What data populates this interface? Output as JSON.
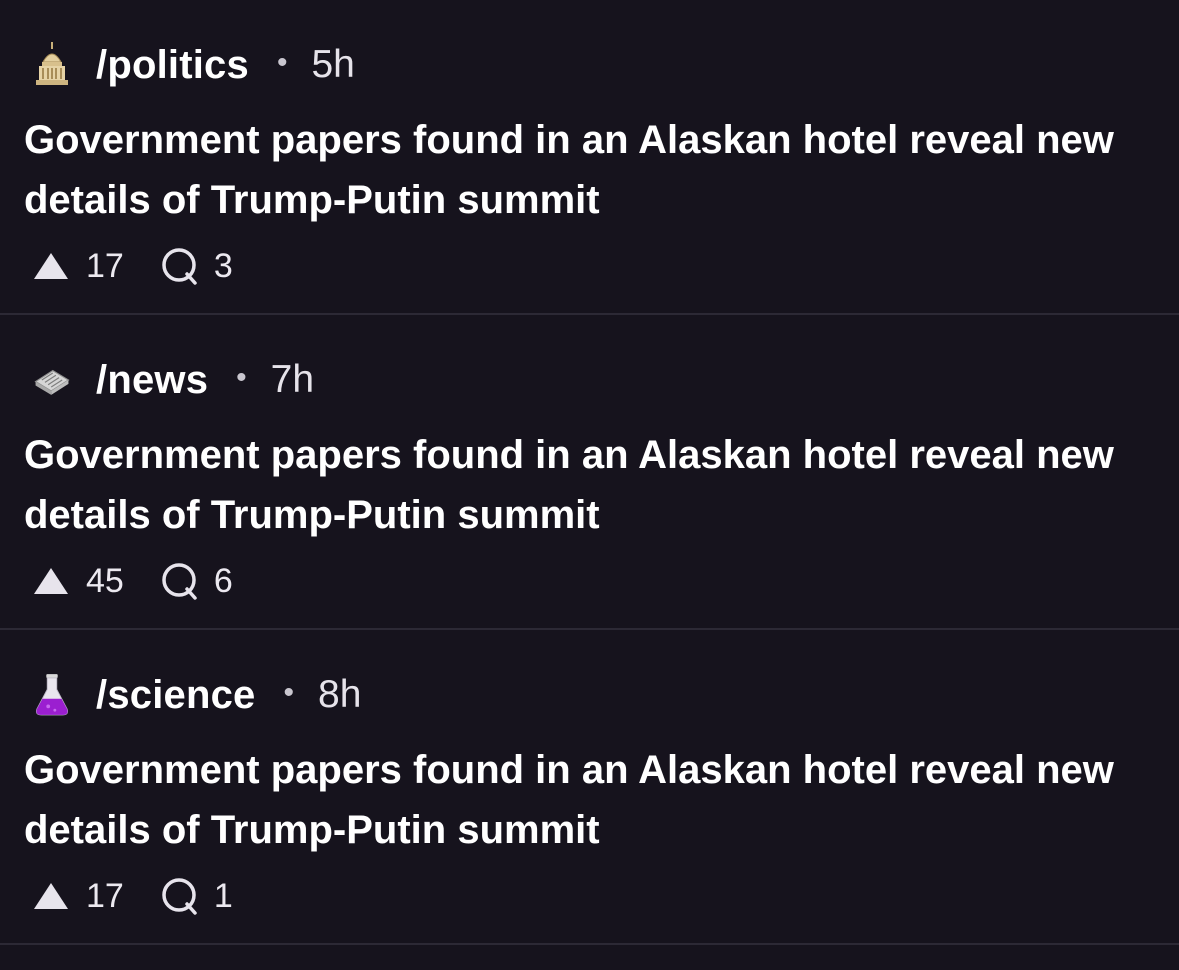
{
  "feed": {
    "posts": [
      {
        "subreddit": "/politics",
        "icon": "capitol-building-icon",
        "age": "5h",
        "title": "Government papers found in an Alaskan hotel reveal new details of Trump-Putin summit",
        "upvotes": "17",
        "comments": "3"
      },
      {
        "subreddit": "/news",
        "icon": "newspaper-icon",
        "age": "7h",
        "title": "Government papers found in an Alaskan hotel reveal new details of Trump-Putin summit",
        "upvotes": "45",
        "comments": "6"
      },
      {
        "subreddit": "/science",
        "icon": "flask-icon",
        "age": "8h",
        "title": "Government papers found in an Alaskan hotel reveal new details of Trump-Putin summit",
        "upvotes": "17",
        "comments": "1"
      }
    ],
    "separator": "•"
  },
  "colors": {
    "background": "#16131d",
    "divider": "#2c2935",
    "text": "#ffffff",
    "muted": "#c9c6cf"
  }
}
